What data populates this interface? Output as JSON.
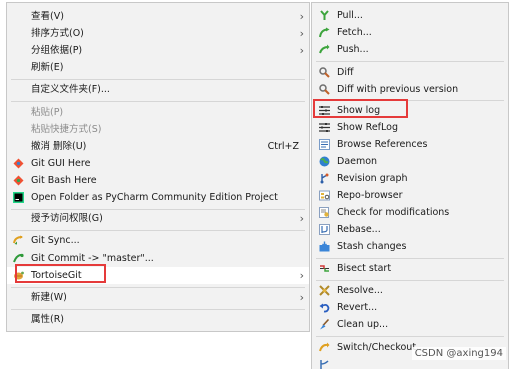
{
  "main_menu": {
    "items": [
      {
        "label": "查看(V)"
      },
      {
        "label": "排序方式(O)"
      },
      {
        "label": "分组依据(P)"
      },
      {
        "label": "刷新(E)"
      },
      {
        "label": "自定义文件夹(F)..."
      },
      {
        "label": "粘贴(P)"
      },
      {
        "label": "粘贴快捷方式(S)"
      },
      {
        "label": "撤消 删除(U)",
        "shortcut": "Ctrl+Z"
      },
      {
        "label": "Git GUI Here"
      },
      {
        "label": "Git Bash Here"
      },
      {
        "label": "Open Folder as PyCharm Community Edition Project"
      },
      {
        "label": "授予访问权限(G)"
      },
      {
        "label": "Git Sync..."
      },
      {
        "label": "Git Commit -> \"master\"..."
      },
      {
        "label": "TortoiseGit"
      },
      {
        "label": "新建(W)"
      },
      {
        "label": "属性(R)"
      }
    ],
    "arrow_glyph": "›"
  },
  "sub_menu": {
    "items": [
      {
        "label": "Pull...",
        "icon": "pull-icon"
      },
      {
        "label": "Fetch...",
        "icon": "fetch-icon"
      },
      {
        "label": "Push...",
        "icon": "push-icon"
      },
      {
        "label": "Diff",
        "icon": "diff-icon"
      },
      {
        "label": "Diff with previous version",
        "icon": "diff-previous-icon"
      },
      {
        "label": "Show log",
        "icon": "show-log-icon"
      },
      {
        "label": "Show RefLog",
        "icon": "reflog-icon"
      },
      {
        "label": "Browse References",
        "icon": "browse-references-icon"
      },
      {
        "label": "Daemon",
        "icon": "daemon-icon"
      },
      {
        "label": "Revision graph",
        "icon": "revision-graph-icon"
      },
      {
        "label": "Repo-browser",
        "icon": "repo-browser-icon"
      },
      {
        "label": "Check for modifications",
        "icon": "check-modifications-icon"
      },
      {
        "label": "Rebase...",
        "icon": "rebase-icon"
      },
      {
        "label": "Stash changes",
        "icon": "stash-icon"
      },
      {
        "label": "Bisect start",
        "icon": "bisect-icon"
      },
      {
        "label": "Resolve...",
        "icon": "resolve-icon"
      },
      {
        "label": "Revert...",
        "icon": "revert-icon"
      },
      {
        "label": "Clean up...",
        "icon": "cleanup-icon"
      },
      {
        "label": "Switch/Checkout...",
        "icon": "switch-checkout-icon"
      }
    ]
  },
  "watermark": "CSDN @axing194",
  "colors": {
    "highlight_box": "#e53a3a",
    "menu_bg": "#f2f2f2",
    "disabled_text": "#8c8c8c"
  }
}
